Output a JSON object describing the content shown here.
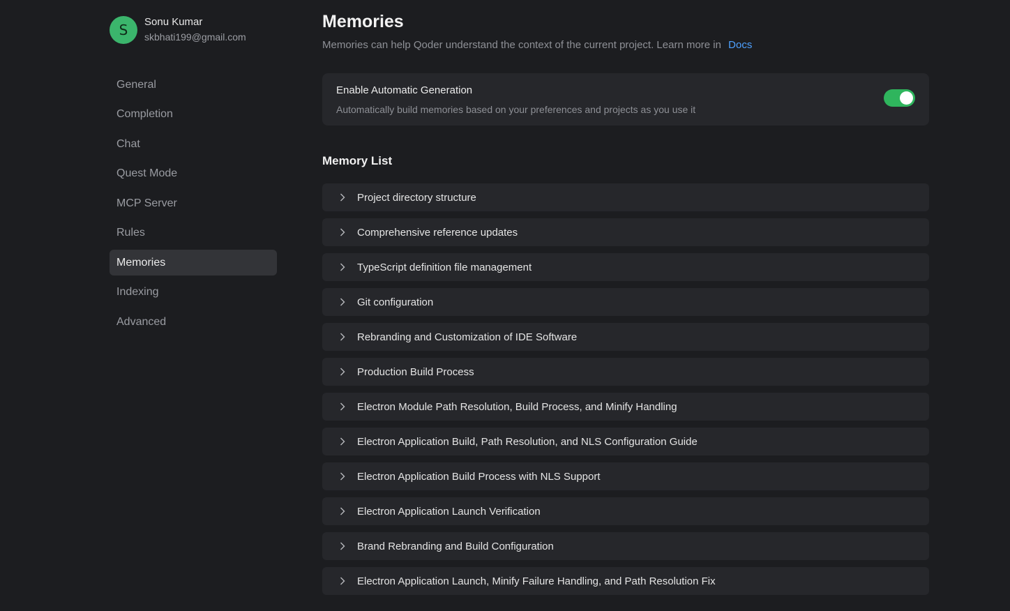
{
  "profile": {
    "initial": "S",
    "name": "Sonu Kumar",
    "email": "skbhati199@gmail.com",
    "avatar_color": "#3bb56c"
  },
  "nav": {
    "items": [
      {
        "label": "General"
      },
      {
        "label": "Completion"
      },
      {
        "label": "Chat"
      },
      {
        "label": "Quest Mode"
      },
      {
        "label": "MCP Server"
      },
      {
        "label": "Rules"
      },
      {
        "label": "Memories",
        "active": true
      },
      {
        "label": "Indexing"
      },
      {
        "label": "Advanced"
      }
    ]
  },
  "page": {
    "title": "Memories",
    "description": "Memories can help Qoder understand the context of the current project. Learn more in",
    "docs_link": "Docs"
  },
  "auto_generation": {
    "title": "Enable Automatic Generation",
    "description": "Automatically build memories based on your preferences and projects as you use it",
    "enabled": true,
    "toggle_color": "#2fb55d"
  },
  "memory_list": {
    "title": "Memory List",
    "items": [
      {
        "label": "Project directory structure"
      },
      {
        "label": "Comprehensive reference updates"
      },
      {
        "label": "TypeScript definition file management"
      },
      {
        "label": "Git configuration"
      },
      {
        "label": "Rebranding and Customization of IDE Software"
      },
      {
        "label": "Production Build Process"
      },
      {
        "label": "Electron Module Path Resolution, Build Process, and Minify Handling"
      },
      {
        "label": "Electron Application Build, Path Resolution, and NLS Configuration Guide"
      },
      {
        "label": "Electron Application Build Process with NLS Support"
      },
      {
        "label": "Electron Application Launch Verification"
      },
      {
        "label": "Brand Rebranding and Build Configuration"
      },
      {
        "label": "Electron Application Launch, Minify Failure Handling, and Path Resolution Fix"
      }
    ]
  },
  "icons": {
    "expand": "chevron-right-icon"
  },
  "colors": {
    "background": "#1c1d20",
    "card": "#26272b",
    "active_nav": "#333438",
    "link": "#4ea1ff"
  }
}
